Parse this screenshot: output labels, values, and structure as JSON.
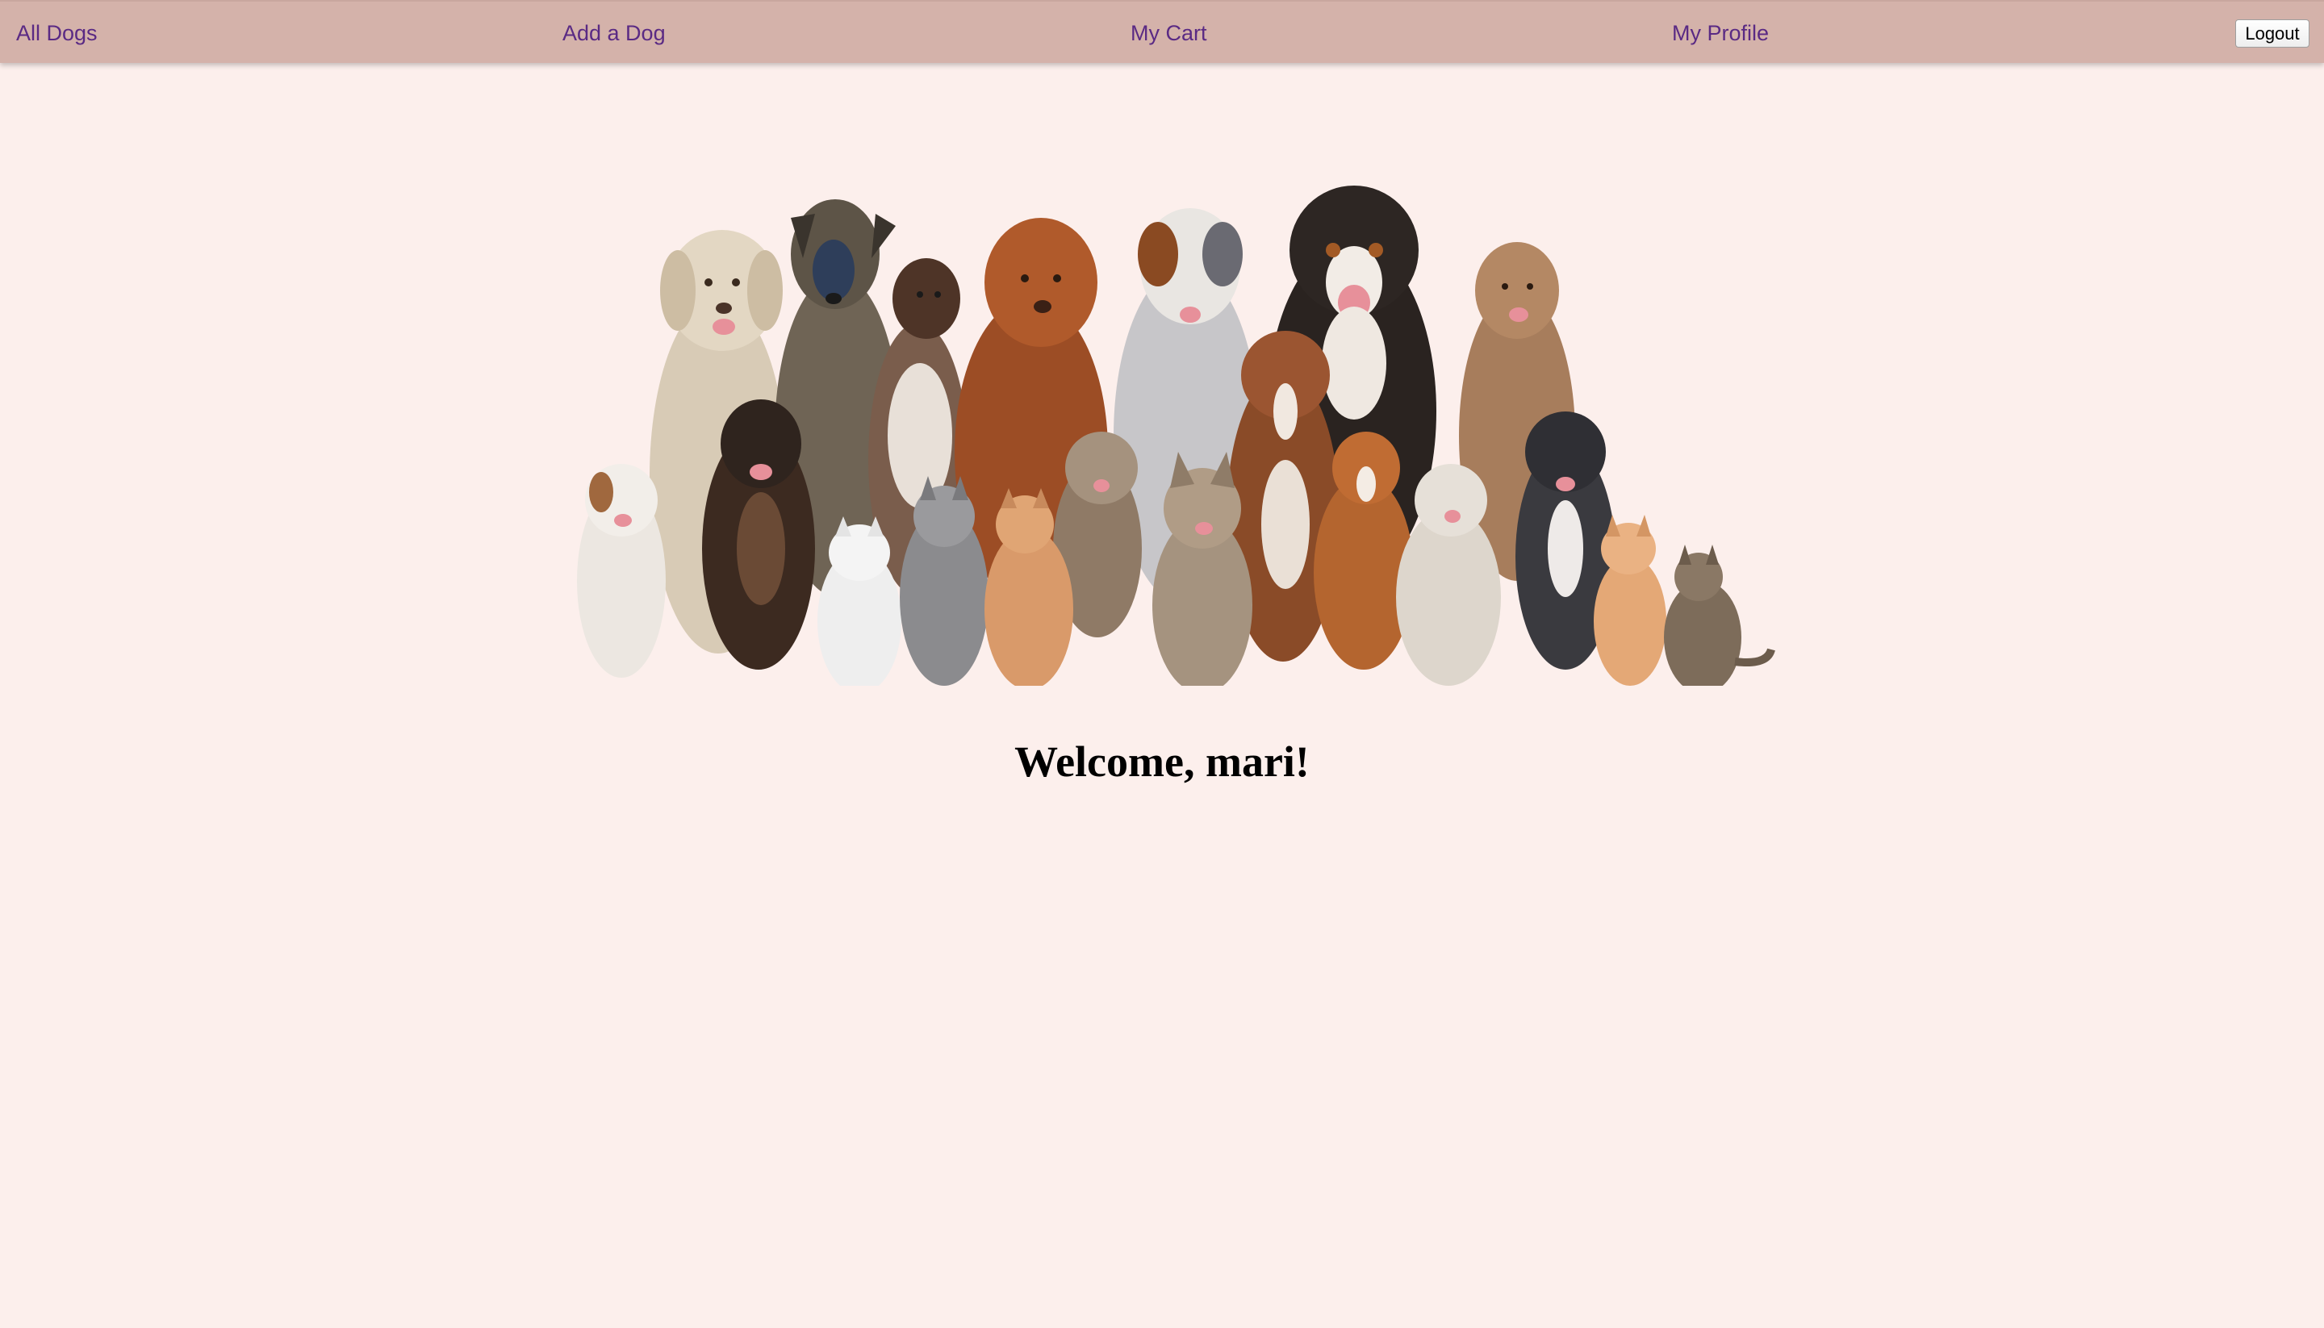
{
  "nav": {
    "links": [
      {
        "label": "All Dogs"
      },
      {
        "label": "Add a Dog"
      },
      {
        "label": "My Cart"
      },
      {
        "label": "My Profile"
      }
    ],
    "logout_label": "Logout"
  },
  "hero": {
    "image_name": "dogs-and-cats-group-illustration"
  },
  "main": {
    "welcome": "Welcome, mari!"
  },
  "colors": {
    "background": "#fcefec",
    "navbar": "#d4b2aa",
    "link": "#5a2a84"
  }
}
